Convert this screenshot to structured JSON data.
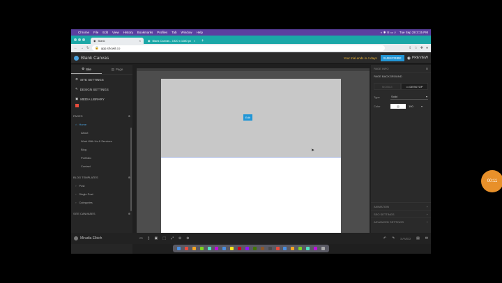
{
  "menubar": {
    "app": "Chrome",
    "items": [
      "File",
      "Edit",
      "View",
      "History",
      "Bookmarks",
      "Profiles",
      "Tab",
      "Window",
      "Help"
    ],
    "clock": "Tue Sep 28 3:15 PM"
  },
  "tabs": [
    {
      "label": "Blank"
    },
    {
      "label": "Blank Canvas - 1920 x 1080 px"
    }
  ],
  "address": {
    "url": "app.showit.co"
  },
  "app_header": {
    "brand": "Blank Canvas",
    "trial": "Your trial ends in 4 days",
    "subscribe": "SUBSCRIBE",
    "preview": "PREVIEW"
  },
  "sidebar": {
    "tabs": [
      {
        "label": "Site"
      },
      {
        "label": "Page"
      }
    ],
    "rows": [
      {
        "label": "SITE SETTINGS"
      },
      {
        "label": "DESIGN SETTINGS"
      },
      {
        "label": "MEDIA LIBRARY"
      }
    ],
    "pages_head": "PAGES",
    "pages": [
      "Home",
      "About",
      "Work With Us & Services",
      "Blog",
      "Portfolio",
      "Contact"
    ],
    "blog_head": "BLOG TEMPLATES",
    "blog": [
      "Post",
      "Single Post",
      "Categories"
    ],
    "canvas_head": "SITE CANVASES"
  },
  "canvas": {
    "edit_label": "Edit"
  },
  "bottombar": {
    "user": "Miradia Elbich",
    "save": "SAVED"
  },
  "right_panel": {
    "head": "PAGE INFO",
    "sub": "PAGE BACKGROUND",
    "toggles": [
      {
        "label": "DESKTOP"
      },
      {
        "label": "MOBILE"
      }
    ],
    "type_label": "Type",
    "type_value": "Solid",
    "color_label": "Color",
    "color_value": "100",
    "foot": [
      "ANIMATION",
      "SEO SETTINGS",
      "ADVANCED SETTINGS"
    ]
  },
  "timer": "00:11",
  "colors": {
    "accent": "#2196d6",
    "menubar": "#5b3fa0",
    "tabbar": "#1aa7a7",
    "trial": "#f0b93a",
    "timer": "#e8902a"
  }
}
